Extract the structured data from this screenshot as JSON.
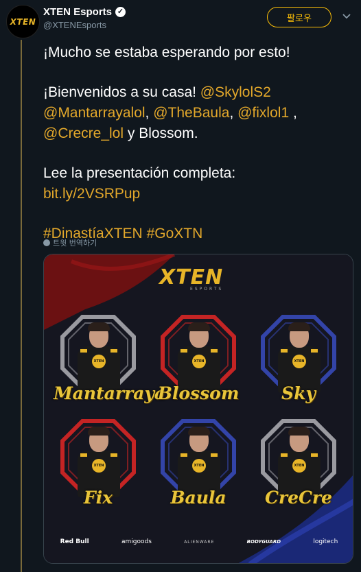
{
  "account": {
    "display_name": "XTEN Esports",
    "handle": "@XTENEsports",
    "avatar_text": "XTEN",
    "verified_mark": "✓"
  },
  "actions": {
    "follow_label": "팔로우"
  },
  "tweet": {
    "line1": "¡Mucho se estaba esperando por esto!",
    "welcome_text": "¡Bienvenidos a su casa! ",
    "mentions": [
      "@SkylolS2",
      "@Mantarrayalol",
      "@TheBaula",
      "@fixlol1",
      "@Crecre_lol"
    ],
    "sep_comma": ", ",
    "sep_comma_space": " ,",
    "mention_end": " y Blossom.",
    "presentation_text": "Lee la presentación completa:",
    "link": "bit.ly/2VSRPup",
    "hashtags": [
      "#DinastíaXTEN",
      "#GoXTN"
    ]
  },
  "translate_label": "트윗 번역하기",
  "media": {
    "brand": "XTEN",
    "brand_sub": "ESPORTS",
    "players": [
      {
        "name": "Mantarraya",
        "frame_color": "#9a9aa0"
      },
      {
        "name": "Blossom",
        "frame_color": "#c42424"
      },
      {
        "name": "Sky",
        "frame_color": "#3344a8"
      },
      {
        "name": "Fix",
        "frame_color": "#c42424"
      },
      {
        "name": "Baula",
        "frame_color": "#3344a8"
      },
      {
        "name": "CreCre",
        "frame_color": "#9a9aa0"
      }
    ],
    "sponsors": [
      "Red Bull",
      "amigoods",
      "ALIENWARE",
      "BODYGUARD",
      "logitech"
    ]
  },
  "colors": {
    "accent": "#ffc107",
    "link": "#e3a82b",
    "background": "#10171e",
    "muted": "#8899a6"
  },
  "icons": {
    "verified": "verified-badge-icon",
    "chevron": "chevron-down-icon",
    "translate": "globe-icon"
  }
}
